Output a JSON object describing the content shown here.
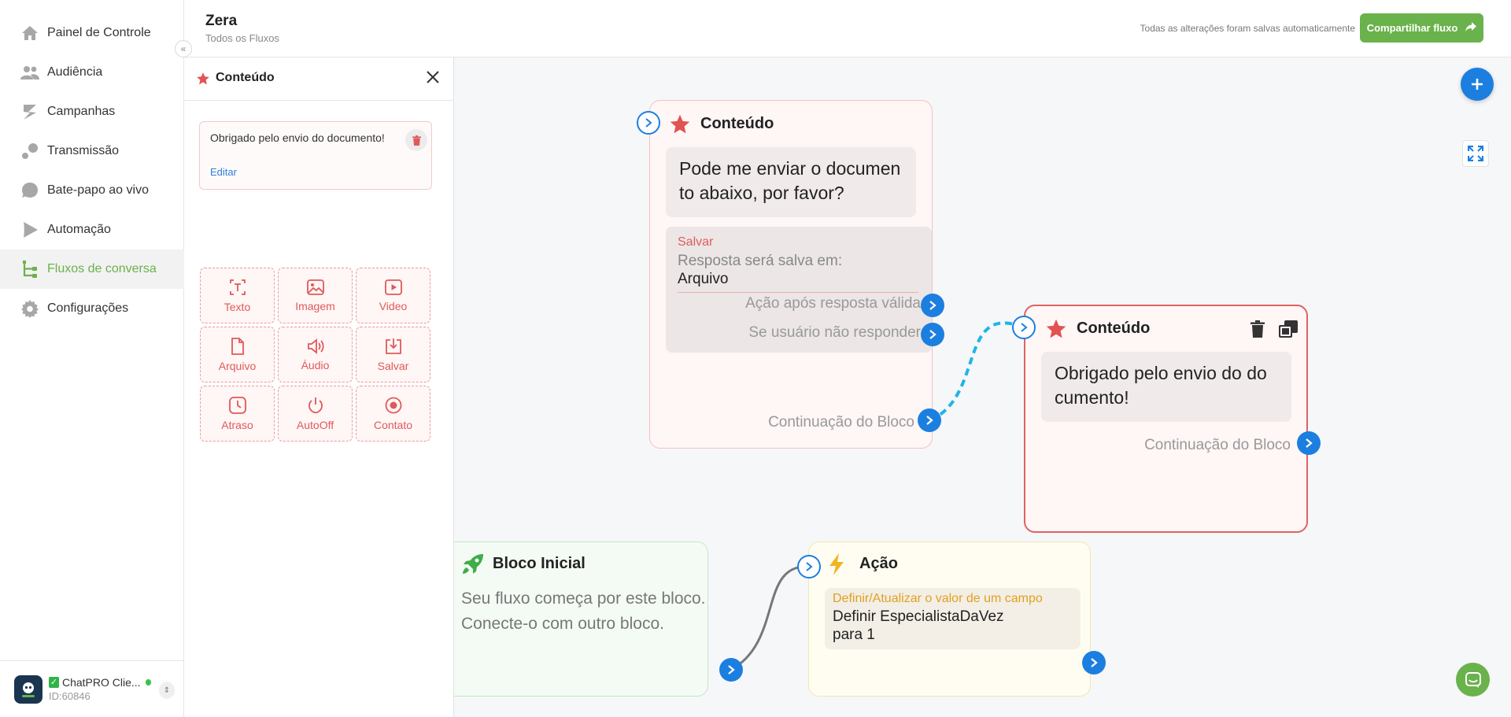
{
  "sidebar": {
    "items": [
      {
        "label": "Painel de Controle",
        "icon": "home-icon"
      },
      {
        "label": "Audiência",
        "icon": "users-icon"
      },
      {
        "label": "Campanhas",
        "icon": "campaign-icon"
      },
      {
        "label": "Transmissão",
        "icon": "broadcast-icon"
      },
      {
        "label": "Bate-papo ao vivo",
        "icon": "chat-bubble-icon"
      },
      {
        "label": "Automação",
        "icon": "play-icon"
      },
      {
        "label": "Fluxos de conversa",
        "icon": "flow-icon"
      },
      {
        "label": "Configurações",
        "icon": "gear-icon"
      }
    ],
    "active_index": 6,
    "account": {
      "name": "ChatPRO Clie...",
      "id": "ID:60846"
    }
  },
  "header": {
    "title": "Zera",
    "subtitle": "Todos os Fluxos",
    "saved_text": "Todas as alterações foram salvas automaticamente",
    "share_label": "Compartilhar fluxo"
  },
  "panel": {
    "title": "Conteúdo",
    "message": "Obrigado pelo envio do documento!",
    "edit_label": "Editar",
    "tools": [
      {
        "label": "Texto",
        "icon": "text-icon"
      },
      {
        "label": "Imagem",
        "icon": "image-icon"
      },
      {
        "label": "Video",
        "icon": "video-icon"
      },
      {
        "label": "Arquivo",
        "icon": "file-icon"
      },
      {
        "label": "Áudio",
        "icon": "audio-icon"
      },
      {
        "label": "Salvar",
        "icon": "save-icon"
      },
      {
        "label": "Atraso",
        "icon": "clock-icon"
      },
      {
        "label": "AutoOff",
        "icon": "power-icon"
      },
      {
        "label": "Contato",
        "icon": "contact-icon"
      }
    ]
  },
  "canvas": {
    "node1": {
      "title": "Conteúdo",
      "message_line1": "Pode me enviar o documen",
      "message_line2": "to abaixo, por favor?",
      "save_title": "Salvar",
      "save_desc": "Resposta será salva em:",
      "save_value": "Arquivo",
      "valid_action": "Ação após resposta válida",
      "no_response": "Se usuário não responder",
      "continuation": "Continuação do Bloco"
    },
    "node2": {
      "title": "Conteúdo",
      "message_line1": "Obrigado pelo envio do do",
      "message_line2": "cumento!",
      "continuation": "Continuação do Bloco"
    },
    "start_node": {
      "title": "Bloco Inicial",
      "desc_line1": "Seu fluxo começa por este bloco.",
      "desc_line2": "Conecte-o com outro bloco."
    },
    "action_node": {
      "title": "Ação",
      "action_title": "Definir/Atualizar o valor de um campo",
      "line1": "Definir EspecialistaDaVez",
      "line2": "para 1"
    }
  },
  "colors": {
    "brand_green": "#6ab24b",
    "accent_blue": "#1c7fe0",
    "content_red": "#e05959",
    "action_yellow": "#e0a020"
  }
}
